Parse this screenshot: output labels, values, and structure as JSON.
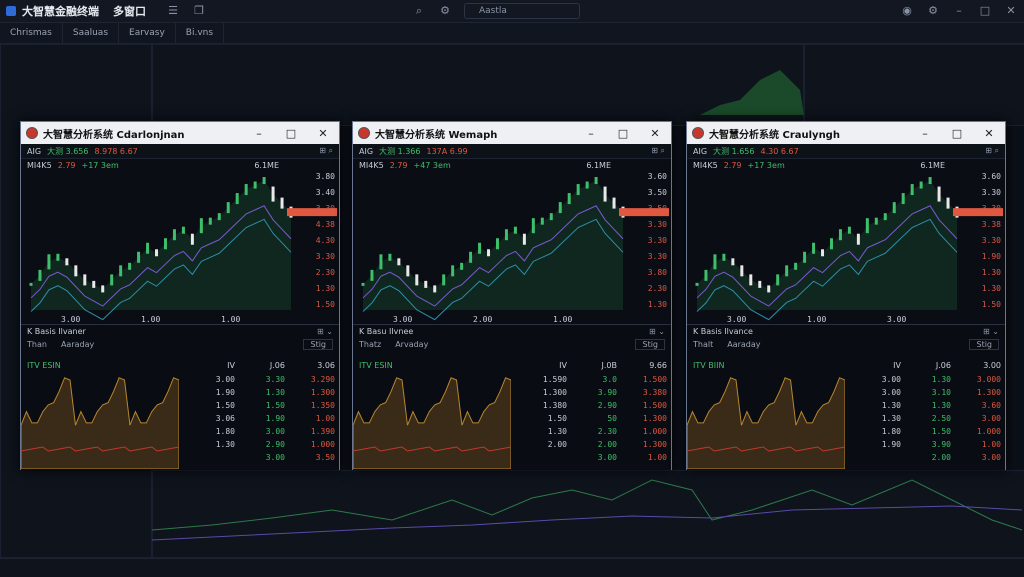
{
  "app": {
    "title": "大智慧金融终端",
    "title_suffix": "多窗口",
    "search_text": "Aastla"
  },
  "subbar": {
    "tabs": [
      "Chrismas",
      "Saaluas",
      "Earvasy",
      "Bi.vns"
    ]
  },
  "colors": {
    "up": "#3fbf6b",
    "down": "#e0583f",
    "bg": "#0b0f17",
    "accent": "#2e6bd8"
  },
  "icons": [
    "app-logo-icon",
    "menu-icon",
    "copy-icon",
    "search-icon",
    "gear-icon",
    "user-icon",
    "settings-icon",
    "close-icon",
    "minimize-icon",
    "maximize-icon"
  ],
  "windows": [
    {
      "title": "大智慧分析系统 Cdarlonjnan",
      "header": {
        "code": "AIG",
        "price_g": "大测 3.656",
        "price_r": "8.978 6.67"
      },
      "sub": {
        "a": "MI4K5",
        "b": "2.79",
        "c": "+17 3em",
        "d": "6.1ME"
      },
      "axis": [
        "3.80",
        "3.40",
        "3.30",
        "4.38",
        "4.30",
        "3.30",
        "2.30",
        "1.30",
        "1.50"
      ],
      "time_labels": [
        "3.00",
        "1.00",
        "1.00"
      ],
      "panel2": {
        "title": "K Basis Ilvaner",
        "row2": "Than",
        "row2b": "Aaraday",
        "ctl": "Stig",
        "label": "ITV ESIN",
        "colhead": [
          "IV",
          "J.06",
          "3.06"
        ],
        "rows": [
          [
            "3.00",
            "3.30",
            "3.290"
          ],
          [
            "1.90",
            "1.30",
            "1.300"
          ],
          [
            "1.50",
            "1.50",
            "1.350"
          ],
          [
            "3.06",
            "1.90",
            "1.00"
          ],
          [
            "1.80",
            "3.00",
            "1.390"
          ],
          [
            "1.30",
            "2.90",
            "1.000"
          ],
          [
            "",
            "3.00",
            "3.50"
          ]
        ]
      }
    },
    {
      "title": "大智慧分析系统 Wemaph",
      "header": {
        "code": "AIG",
        "price_g": "大测 1.366",
        "price_r": "137A 6.99"
      },
      "sub": {
        "a": "MI4K5",
        "b": "2.79",
        "c": "+47 3em",
        "d": "6.1ME"
      },
      "axis": [
        "3.60",
        "3.50",
        "3.50",
        "3.30",
        "3.30",
        "3.30",
        "3.80",
        "2.30",
        "1.30"
      ],
      "time_labels": [
        "3.00",
        "2.00",
        "1.00"
      ],
      "panel2": {
        "title": "K Basu IIvnee",
        "row2": "Thatz",
        "row2b": "Arvaday",
        "ctl": "Stig",
        "label": "ITV ESIN",
        "colhead": [
          "IV",
          "J.0B",
          "9.66"
        ],
        "rows": [
          [
            "1.590",
            "3.0",
            "1.500"
          ],
          [
            "1.300",
            "3.90",
            "3.380"
          ],
          [
            "1.380",
            "2.90",
            "1.500"
          ],
          [
            "1.50",
            "50",
            "1.300"
          ],
          [
            "1.30",
            "2.30",
            "1.000"
          ],
          [
            "2.00",
            "2.00",
            "1.300"
          ],
          [
            "",
            "3.00",
            "1.00"
          ]
        ]
      }
    },
    {
      "title": "大智慧分析系统 Craulyngh",
      "header": {
        "code": "AIG",
        "price_g": "大测 1.656",
        "price_r": "4.30 6.67"
      },
      "sub": {
        "a": "MI4K5",
        "b": "2.79",
        "c": "+17 3em",
        "d": "6.1ME"
      },
      "axis": [
        "3.60",
        "3.30",
        "3.30",
        "3.38",
        "3.30",
        "1.90",
        "1.30",
        "1.30",
        "1.50"
      ],
      "time_labels": [
        "3.00",
        "1.00",
        "3.00"
      ],
      "panel2": {
        "title": "K Basis Ilvance",
        "row2": "Thalt",
        "row2b": "Aaraday",
        "ctl": "Stig",
        "label": "ITV BIIN",
        "colhead": [
          "IV",
          "J.06",
          "3.00"
        ],
        "rows": [
          [
            "3.00",
            "1.30",
            "3.000"
          ],
          [
            "3.00",
            "3.10",
            "1.300"
          ],
          [
            "1.30",
            "1.30",
            "3.60"
          ],
          [
            "1.30",
            "2.50",
            "3.00"
          ],
          [
            "1.80",
            "1.50",
            "1.000"
          ],
          [
            "1.90",
            "3.90",
            "1.00"
          ],
          [
            "",
            "2.00",
            "3.00"
          ]
        ]
      }
    }
  ],
  "chart_data": {
    "type": "line",
    "title": "",
    "x": [
      0,
      1,
      2,
      3,
      4,
      5,
      6,
      7,
      8,
      9,
      10,
      11,
      12,
      13,
      14,
      15,
      16,
      17,
      18,
      19,
      20,
      21,
      22,
      23,
      24,
      25,
      26,
      27,
      28,
      29
    ],
    "series": [
      {
        "values": [
          2.0,
          2.2,
          2.5,
          2.6,
          2.5,
          2.3,
          2.1,
          2.0,
          1.9,
          2.1,
          2.3,
          2.4,
          2.6,
          2.8,
          2.7,
          2.9,
          3.1,
          3.2,
          3.0,
          3.3,
          3.4,
          3.5,
          3.7,
          3.9,
          4.1,
          4.2,
          4.3,
          4.0,
          3.8,
          3.6
        ]
      }
    ],
    "ylim": [
      1.3,
      4.4
    ]
  }
}
